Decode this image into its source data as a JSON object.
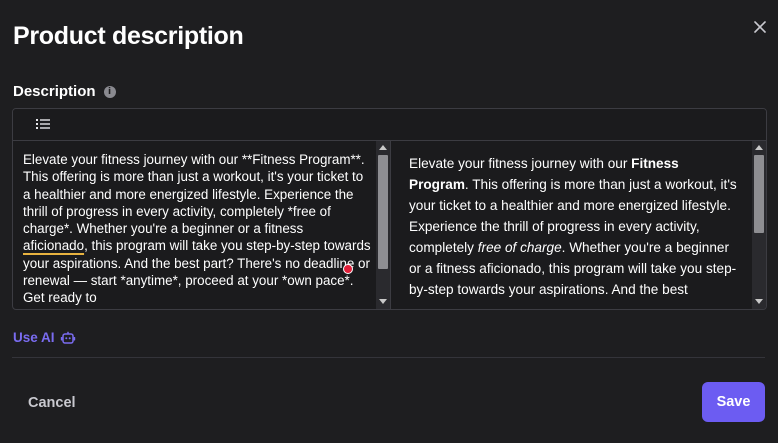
{
  "dialog": {
    "title": "Product description",
    "close_icon": "close-icon"
  },
  "field": {
    "label": "Description",
    "info_icon": "info-icon",
    "info_glyph": "i"
  },
  "toolbar": {
    "list_icon": "unordered-list-icon"
  },
  "editor": {
    "source": {
      "before_underlined": "Elevate your fitness journey with our **Fitness Program**. This offering is more than just a workout, it's your ticket to a healthier and more energized lifestyle. Experience the thrill of progress in every activity, completely *free of charge*. Whether you're a beginner or a fitness ",
      "underlined_word": "aficionado",
      "after_underlined": ", this program will take you step-by-step towards your aspirations. And the best part? There's no deadline or renewal — start *anytime*, proceed at your *own pace*. Get ready to"
    },
    "preview": {
      "p1": "Elevate your fitness journey with our ",
      "bold1": "Fitness Program",
      "p2": ". This offering is more than just a workout, it's your ticket to a healthier and more energized lifestyle. Experience the thrill of progress in every activity, completely ",
      "italic1": "free of charge",
      "p3": ". Whether you're a beginner or a fitness aficionado, this program will take you step-by-step towards your aspirations. And the best"
    }
  },
  "use_ai": {
    "label": "Use AI",
    "icon": "robot-icon"
  },
  "footer": {
    "cancel_label": "Cancel",
    "save_label": "Save"
  },
  "colors": {
    "background": "#1e1e20",
    "accent": "#6c5cf2",
    "ai_link": "#7a6cf0",
    "spell_underline": "#e8b340",
    "marker_dot": "#e0203a"
  }
}
